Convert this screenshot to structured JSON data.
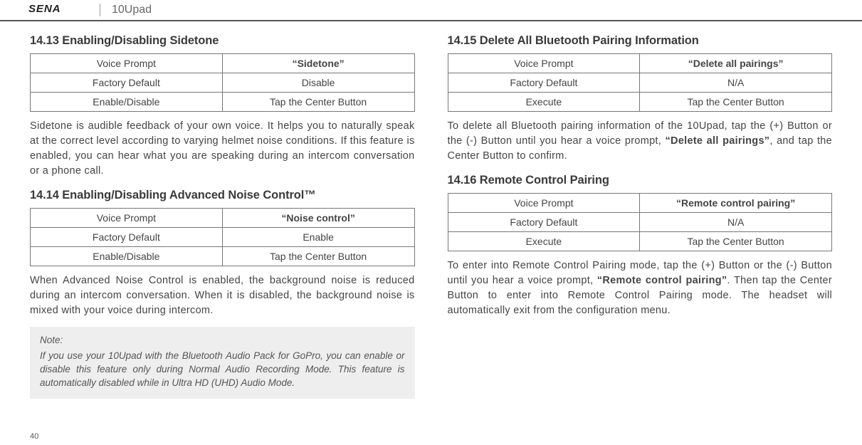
{
  "header": {
    "logo_text": "SENA",
    "product": "10Upad"
  },
  "left": {
    "s1": {
      "title": "14.13 Enabling/Disabling Sidetone",
      "r1a": "Voice Prompt",
      "r1b": "“Sidetone”",
      "r2a": "Factory Default",
      "r2b": "Disable",
      "r3a": "Enable/Disable",
      "r3b": "Tap the Center Button",
      "body": "Sidetone is audible feedback of your own voice. It helps you to naturally speak at the correct level according to varying helmet noise conditions. If this feature is enabled, you can hear what you are speaking during an intercom conversation or a phone call."
    },
    "s2": {
      "title": "14.14 Enabling/Disabling Advanced Noise Control™",
      "r1a": "Voice Prompt",
      "r1b": "“Noise control”",
      "r2a": "Factory Default",
      "r2b": "Enable",
      "r3a": "Enable/Disable",
      "r3b": "Tap the Center Button",
      "body": "When Advanced Noise Control is enabled, the background noise is reduced during an intercom conversation. When it is disabled, the background noise is mixed with your voice during intercom.",
      "note_label": "Note:",
      "note_body": "If you use your 10Upad with the Bluetooth Audio Pack for GoPro, you can enable or disable this feature only during Normal Audio Recording Mode. This feature is automatically disabled while in Ultra HD (UHD) Audio Mode."
    }
  },
  "right": {
    "s3": {
      "title": "14.15 Delete All Bluetooth Pairing Information",
      "r1a": "Voice Prompt",
      "r1b": "“Delete all pairings”",
      "r2a": "Factory Default",
      "r2b": "N/A",
      "r3a": "Execute",
      "r3b": "Tap the Center Button",
      "body_pre": "To delete all Bluetooth pairing information of the 10Upad, tap the (+) Button or the (-) Button until you hear a voice prompt, ",
      "body_bold": "“Delete all pairings”",
      "body_post": ", and tap the Center Button to confirm."
    },
    "s4": {
      "title": "14.16 Remote Control Pairing",
      "r1a": "Voice Prompt",
      "r1b": "“Remote control pairing”",
      "r2a": "Factory Default",
      "r2b": "N/A",
      "r3a": "Execute",
      "r3b": "Tap the Center Button",
      "body_pre": "To enter into Remote Control Pairing mode, tap the (+) Button or the (-) Button until you hear a voice prompt, ",
      "body_bold": "“Remote control pairing”",
      "body_post": ". Then tap the Center Button to enter into Remote Control Pairing mode. The headset will automatically exit from the configuration menu."
    }
  },
  "pagenum": "40"
}
